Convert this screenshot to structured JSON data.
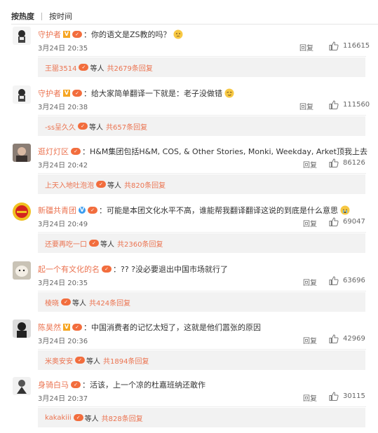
{
  "sort": {
    "hot": "按热度",
    "time": "按时间"
  },
  "reply_label": "回复",
  "sub_mid": "等人",
  "comments": [
    {
      "user": "守护者",
      "badge": "V",
      "badge_color": "orange",
      "text": "：你的语文是ZS教的吗？",
      "emoji": "think-emoji",
      "date": "3月24日 20:35",
      "likes": "116615",
      "sub_user": "王罂3514",
      "sub_total": "共2679条回复"
    },
    {
      "user": "守护者",
      "badge": "V",
      "badge_color": "orange",
      "text": "：给大家简单翻译一下就是：老子没做错",
      "emoji": "smirk-emoji",
      "date": "3月24日 20:38",
      "likes": "111560",
      "sub_user": "-ss呈久久",
      "sub_total": "共657条回复"
    },
    {
      "user": "逛灯灯区",
      "badge": "",
      "badge_color": "",
      "text": "：H&M集团包括H&M, COS, & Other Stories, Monki, Weekday, Arket顶我上去",
      "emoji": "",
      "date": "3月24日 20:42",
      "likes": "86126",
      "sub_user": "上天入地吐泡泡",
      "sub_total": "共820条回复"
    },
    {
      "user": "新疆共青团",
      "badge": "V",
      "badge_color": "blue",
      "text": "：可能是本团文化水平不高，谁能帮我翻译翻译这说的到底是什么意思",
      "emoji": "cry-emoji",
      "date": "3月24日 20:49",
      "likes": "69047",
      "sub_user": "还要再吃一口",
      "sub_total": "共2360条回复"
    },
    {
      "user": "起一个有文化的名",
      "badge": "",
      "badge_color": "",
      "text": "：?? ?没必要退出中国市场就行了",
      "emoji": "",
      "date": "3月24日 20:35",
      "likes": "63696",
      "sub_user": "棱晓",
      "sub_total": "共424条回复"
    },
    {
      "user": "陈昊然",
      "badge": "V",
      "badge_color": "orange",
      "text": "：中国消费者的记忆太短了，这就是他们嚣张的原因",
      "emoji": "",
      "date": "3月24日 20:36",
      "likes": "42969",
      "sub_user": "米奥安安",
      "sub_total": "共1894条回复"
    },
    {
      "user": "身骑白马",
      "badge": "",
      "badge_color": "",
      "text": "：活该，上一个凉的杜嘉班纳还敢作",
      "emoji": "",
      "date": "3月24日 20:37",
      "likes": "30115",
      "sub_user": "kakakiii",
      "sub_total": "共828条回复"
    }
  ]
}
